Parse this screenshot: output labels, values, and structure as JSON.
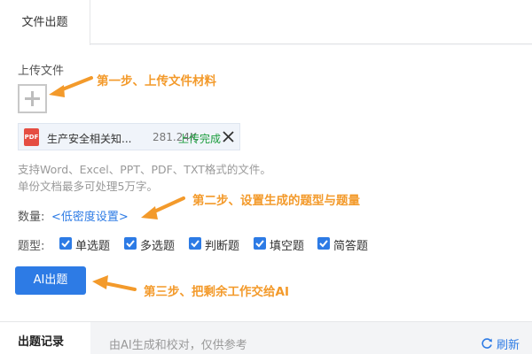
{
  "tabs": {
    "active": "文件出题"
  },
  "upload": {
    "label": "上传文件",
    "file": {
      "icon_text": "PDF",
      "name": "生产安全相关知...",
      "size": "281.24K",
      "status": "上传完成"
    },
    "hint_line1": "支持Word、Excel、PPT、PDF、TXT格式的文件。",
    "hint_line2": "单份文档最多可处理5万字。"
  },
  "quantity": {
    "label": "数量:",
    "link": "<低密度设置>"
  },
  "question_types": {
    "label": "题型:",
    "options": [
      {
        "label": "单选题",
        "checked": true
      },
      {
        "label": "多选题",
        "checked": true
      },
      {
        "label": "判断题",
        "checked": true
      },
      {
        "label": "填空题",
        "checked": true
      },
      {
        "label": "简答题",
        "checked": true
      }
    ]
  },
  "ai_button": {
    "label": "AI出题"
  },
  "annotations": {
    "step1": "第一步、上传文件材料",
    "step2": "第二步、设置生成的题型与题量",
    "step3": "第三步、把剩余工作交给AI"
  },
  "bottom": {
    "tab": "出题记录",
    "info": "由AI生成和校对，仅供参考",
    "refresh": "刷新"
  },
  "colors": {
    "accent": "#2d7be5",
    "annotation": "#f39a2b",
    "success": "#1a9c3c",
    "pdf": "#e54d42"
  }
}
